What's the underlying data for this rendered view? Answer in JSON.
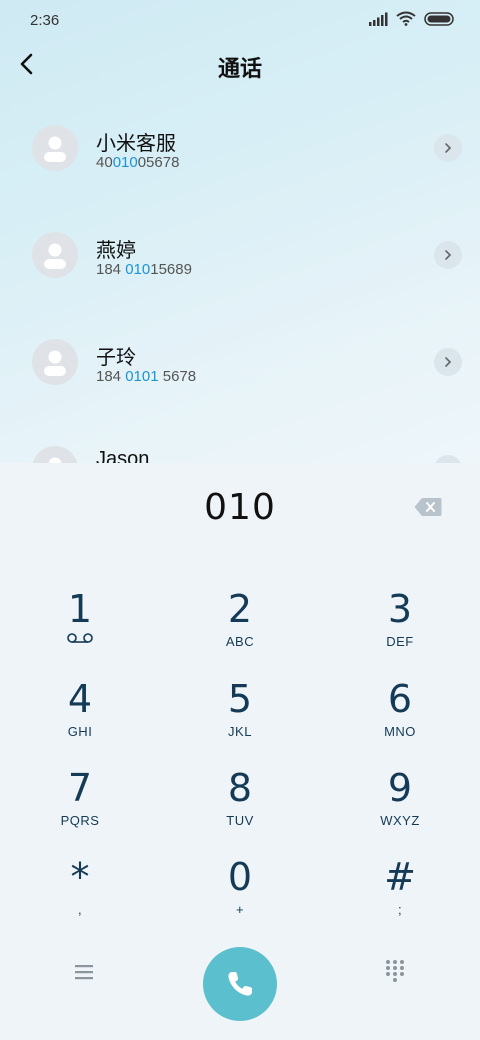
{
  "status_bar": {
    "time": "2:36"
  },
  "header": {
    "title": "通话"
  },
  "contacts": [
    {
      "name": "小米客服",
      "number_pre": "40",
      "number_match": "010",
      "number_post": "05678"
    },
    {
      "name": "燕婷",
      "number_pre": "184 ",
      "number_match": "010",
      "number_post": "15689"
    },
    {
      "name": "子玲",
      "number_pre": "184 ",
      "number_match": "0101",
      "number_post": " 5678"
    },
    {
      "name": "Jason",
      "number_pre": "",
      "number_match": "",
      "number_post": ""
    }
  ],
  "dialer": {
    "entered": "010",
    "keys": [
      {
        "digit": "1",
        "letters": ""
      },
      {
        "digit": "2",
        "letters": "ABC"
      },
      {
        "digit": "3",
        "letters": "DEF"
      },
      {
        "digit": "4",
        "letters": "GHI"
      },
      {
        "digit": "5",
        "letters": "JKL"
      },
      {
        "digit": "6",
        "letters": "MNO"
      },
      {
        "digit": "7",
        "letters": "PQRS"
      },
      {
        "digit": "8",
        "letters": "TUV"
      },
      {
        "digit": "9",
        "letters": "WXYZ"
      },
      {
        "digit": "*",
        "letters": ","
      },
      {
        "digit": "0",
        "letters": "+"
      },
      {
        "digit": "#",
        "letters": ";"
      }
    ]
  },
  "icons": {
    "back": "back-arrow-icon",
    "arrow": "chevron-right-icon",
    "voicemail": "voicemail-icon",
    "backspace": "backspace-icon",
    "menu": "menu-icon",
    "call": "phone-icon",
    "grid": "keypad-grid-icon"
  },
  "colors": {
    "highlight": "#1c93d2",
    "call_button": "#5bbfce",
    "key_text": "#143a55"
  }
}
